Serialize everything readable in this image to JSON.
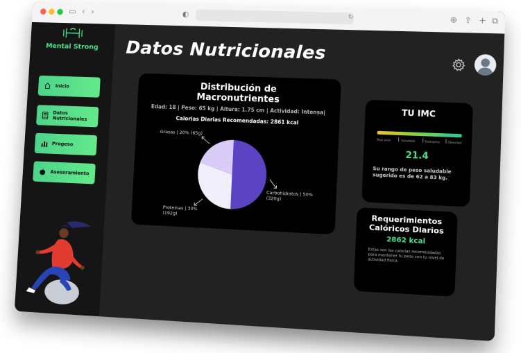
{
  "app": {
    "brand": "Mental Strong"
  },
  "sidebar": {
    "items": [
      {
        "label": "Inicio",
        "icon": "home-icon"
      },
      {
        "label": "Datos Nutricionales",
        "icon": "calculator-icon"
      },
      {
        "label": "Progeso",
        "icon": "bar-chart-icon"
      },
      {
        "label": "Asesoramiento",
        "icon": "apple-icon"
      }
    ]
  },
  "header": {
    "title": "Datos Nutricionales",
    "settings_icon": "gear-icon",
    "avatar_icon": "user-avatar-icon"
  },
  "macros": {
    "title_line1": "Distribución de",
    "title_line2": "Macronutrientes",
    "meta": "Edad: 18 | Peso: 65 kg | Altura: 1.75 cm |  Actividad: Intensa|",
    "kcal": "Calorias Diarias Recomendadas: 2861 kcal",
    "labels": {
      "grasas": "Grasas | 20% (65g)",
      "carbo_1": "Carbohidratos | 50%",
      "carbo_2": "(320g)",
      "prot_1": "Proteinas   | 30%",
      "prot_2": "(192g)"
    }
  },
  "chart_data": {
    "type": "pie",
    "title": "Distribución de Macronutrientes",
    "categories": [
      "Carbohidratos",
      "Proteinas",
      "Grasas"
    ],
    "values": [
      50,
      30,
      20
    ],
    "grams": [
      320,
      192,
      65
    ],
    "colors": [
      "#5b43c4",
      "#f1eefc",
      "#d9cdf7"
    ]
  },
  "imc": {
    "title": "TU IMC",
    "categories": [
      "Bajo peso",
      "Saludable",
      "Sobrepeso",
      "Obesidad"
    ],
    "value": "21.4",
    "text": "Su rango de peso saludable sugerido es de 62 a 83 kg."
  },
  "requirements": {
    "title_line1": "Requerimientos",
    "title_line2": "Calóricos Diarios",
    "value": "2862 kcal",
    "text": "Estas son las calorías recomendadas para mantener tu peso con tu nivel de actividad física."
  },
  "colors": {
    "accent": "#4ee08a",
    "sidebar": "#151515",
    "main": "#222222",
    "card": "#000000"
  }
}
